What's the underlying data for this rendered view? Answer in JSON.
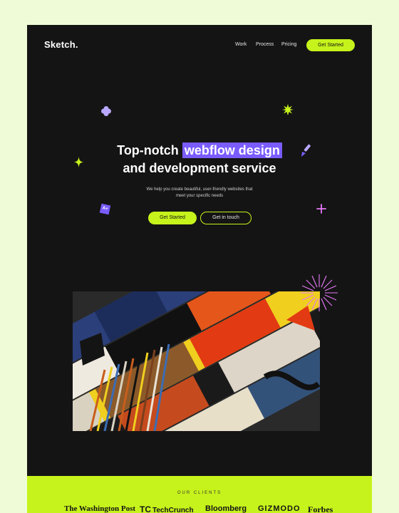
{
  "brand": {
    "logo": "Sketch."
  },
  "nav": {
    "links": [
      "Work",
      "Process",
      "Pricing"
    ],
    "cta": "Get Started"
  },
  "hero": {
    "title_part1": "Top-notch",
    "title_highlight": "webflow design",
    "title_line2": "and development service",
    "subtitle_line1": "We help you create beautiful, user-friendly websites that",
    "subtitle_line2": "meet your specific needs",
    "primary_button": "Get Started",
    "secondary_button": "Get in touch",
    "badge_text": "A+"
  },
  "clients": {
    "label": "OUR CLIENTS",
    "logos": [
      "The Washington Post",
      "TechCrunch",
      "Bloomberg",
      "GIZMODO",
      "Forbes"
    ]
  },
  "colors": {
    "page_bg": "#eefbd6",
    "dark_bg": "#141414",
    "accent_lime": "#c6f31b",
    "accent_purple": "#7a5cff",
    "accent_pink": "#e879f9",
    "accent_lavender": "#b9a8ff"
  },
  "icons": [
    "flower-icon",
    "sparkle-icon",
    "star-burst-icon",
    "brush-icon",
    "plus-icon",
    "grade-badge-icon",
    "sunburst-icon"
  ]
}
